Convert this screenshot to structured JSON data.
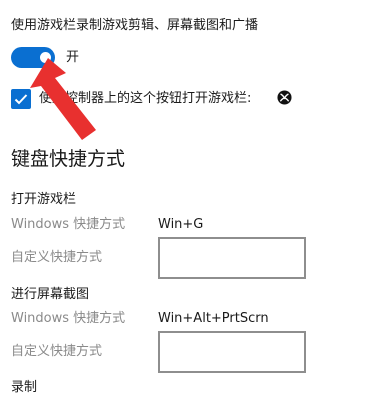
{
  "top_setting": {
    "label": "使用游戏栏录制游戏剪辑、屏幕截图和广播",
    "toggle_state_label": "开",
    "toggle_on": true
  },
  "controller_setting": {
    "label": "使用控制器上的这个按钮打开游戏栏:",
    "checked": true,
    "icon": "xbox-icon"
  },
  "shortcuts": {
    "heading": "键盘快捷方式",
    "groups": [
      {
        "title": "打开游戏栏",
        "windows_label": "Windows 快捷方式",
        "windows_value": "Win+G",
        "custom_label": "自定义快捷方式",
        "custom_value": ""
      },
      {
        "title": "进行屏幕截图",
        "windows_label": "Windows 快捷方式",
        "windows_value": "Win+Alt+PrtScrn",
        "custom_label": "自定义快捷方式",
        "custom_value": ""
      },
      {
        "title": "录制"
      }
    ]
  },
  "colors": {
    "accent": "#0a6fd1",
    "annotation_arrow": "#e8302f",
    "muted_text": "#8a8a8a"
  }
}
